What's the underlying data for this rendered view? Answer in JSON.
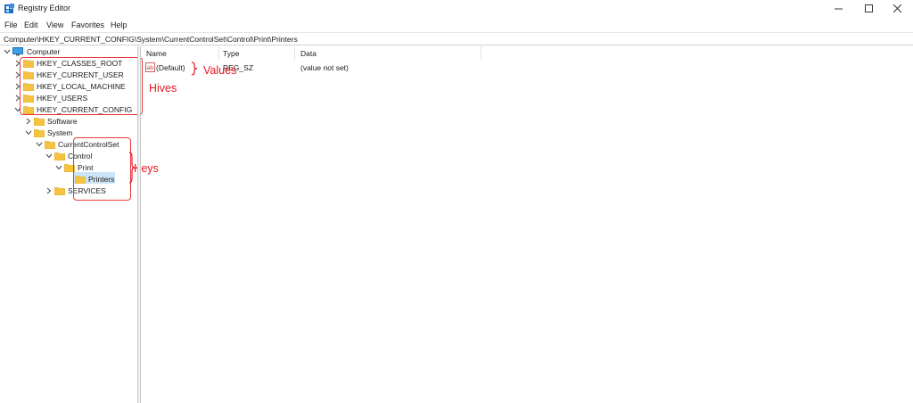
{
  "window": {
    "title": "Registry Editor",
    "controls": {
      "minimize": "minimize",
      "maximize": "maximize",
      "close": "close"
    }
  },
  "menu": [
    "File",
    "Edit",
    "View",
    "Favorites",
    "Help"
  ],
  "address": "Computer\\HKEY_CURRENT_CONFIG\\System\\CurrentControlSet\\Control\\Print\\Printers",
  "tree": {
    "root": "Computer",
    "hives": [
      "HKEY_CLASSES_ROOT",
      "HKEY_CURRENT_USER",
      "HKEY_LOCAL_MACHINE",
      "HKEY_USERS",
      "HKEY_CURRENT_CONFIG"
    ],
    "keys": {
      "software": "Software",
      "system": "System",
      "ccs": "CurrentControlSet",
      "control": "Control",
      "print": "Print",
      "printers": "Printers",
      "services": "SERVICES"
    }
  },
  "list": {
    "columns": [
      "Name",
      "Type",
      "Data"
    ],
    "rows": [
      {
        "name": "(Default)",
        "type": "REG_SZ",
        "data": "(value not set)"
      }
    ]
  },
  "annotations": {
    "hives": "Hives",
    "keys": "Keys",
    "values": "Values"
  },
  "colors": {
    "annotation": "#e8141e",
    "selection": "#cce4f7",
    "folder": "#f5c242"
  }
}
